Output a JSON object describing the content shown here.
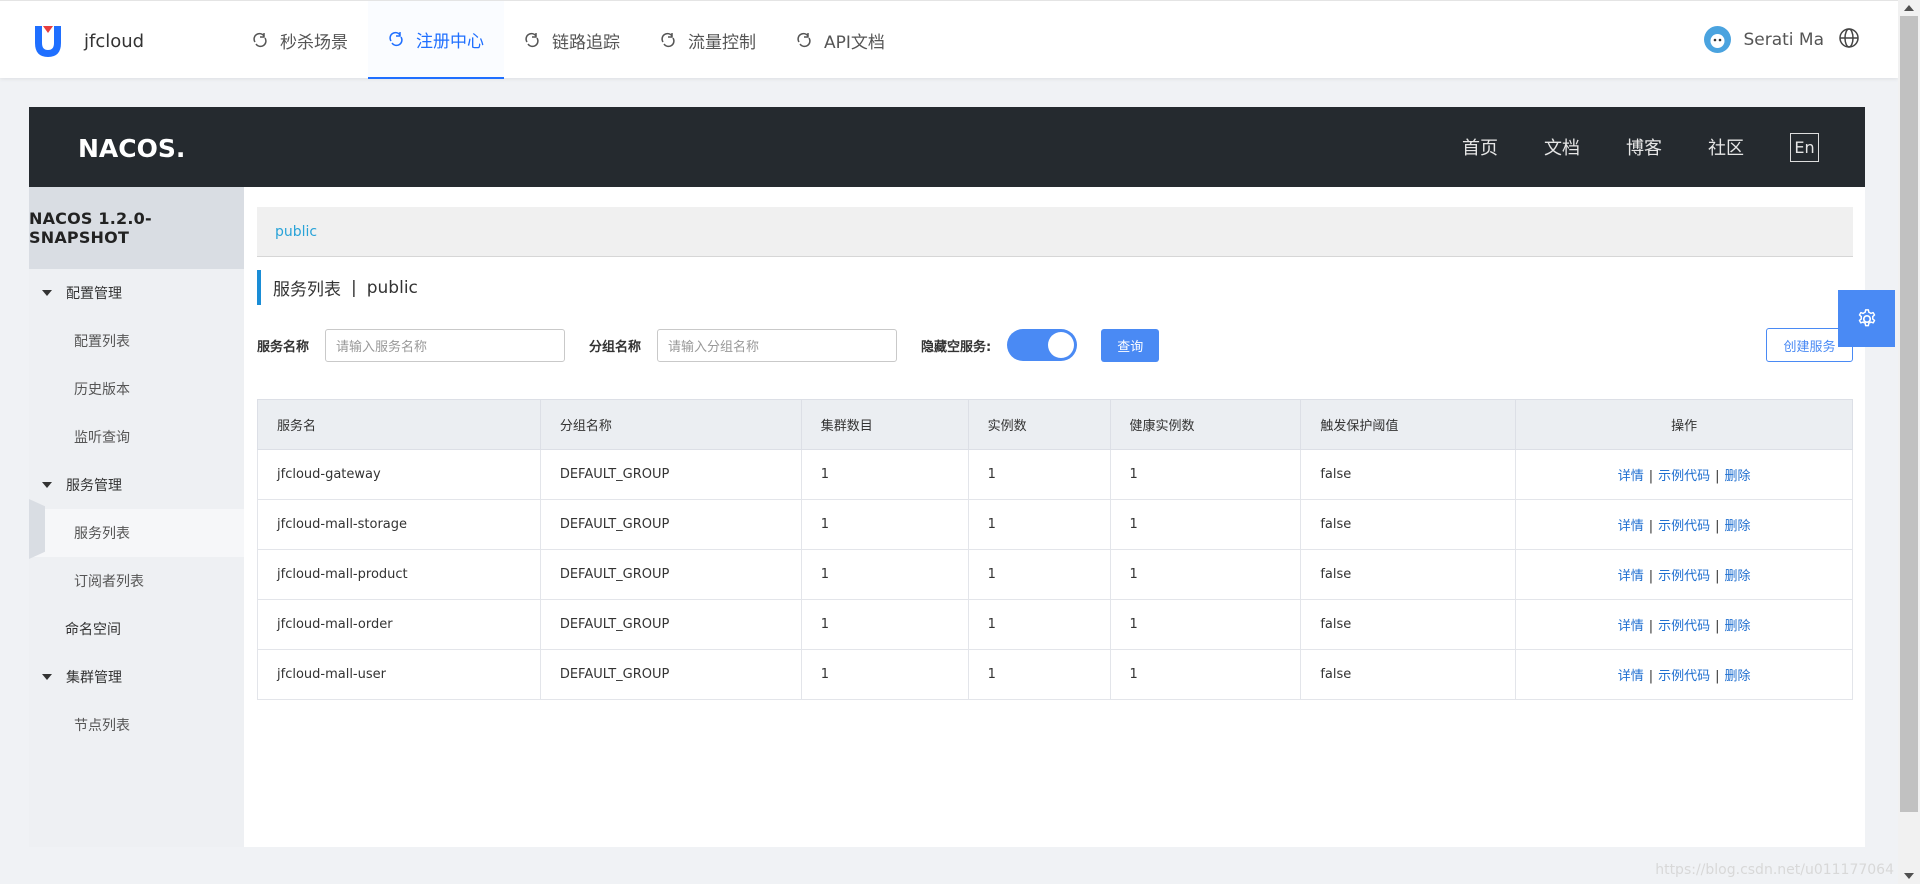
{
  "app": {
    "name": "jfcloud",
    "nav": [
      {
        "label": "秒杀场景",
        "active": false
      },
      {
        "label": "注册中心",
        "active": true
      },
      {
        "label": "链路追踪",
        "active": false
      },
      {
        "label": "流量控制",
        "active": false
      },
      {
        "label": "API文档",
        "active": false
      }
    ],
    "user_name": "Serati Ma",
    "accent": "#1f6fff"
  },
  "nacos": {
    "logo_text": "NACOS.",
    "nav": [
      "首页",
      "文档",
      "博客",
      "社区"
    ],
    "lang": "En",
    "header_bg": "#252a2f"
  },
  "sidebar": {
    "title": "NACOS 1.2.0-SNAPSHOT",
    "groups": [
      {
        "label": "配置管理",
        "items": [
          "配置列表",
          "历史版本",
          "监听查询"
        ]
      },
      {
        "label": "服务管理",
        "items": [
          "服务列表",
          "订阅者列表"
        ]
      },
      {
        "label": "命名空间",
        "items": []
      },
      {
        "label": "集群管理",
        "items": [
          "节点列表"
        ]
      }
    ],
    "active_item": "服务列表"
  },
  "main": {
    "breadcrumb": "public",
    "title": "服务列表",
    "title_sep": "|",
    "namespace": "public",
    "filters": {
      "service_label": "服务名称",
      "service_placeholder": "请输入服务名称",
      "group_label": "分组名称",
      "group_placeholder": "请输入分组名称",
      "hide_empty_label": "隐藏空服务:",
      "hide_empty_on": true,
      "query_label": "查询",
      "create_label": "创建服务"
    },
    "table": {
      "columns": [
        "服务名",
        "分组名称",
        "集群数目",
        "实例数",
        "健康实例数",
        "触发保护阈值",
        "操作"
      ],
      "rows": [
        {
          "name": "jfcloud-gateway",
          "group": "DEFAULT_GROUP",
          "clusters": "1",
          "instances": "1",
          "healthy": "1",
          "protect": "false"
        },
        {
          "name": "jfcloud-mall-storage",
          "group": "DEFAULT_GROUP",
          "clusters": "1",
          "instances": "1",
          "healthy": "1",
          "protect": "false"
        },
        {
          "name": "jfcloud-mall-product",
          "group": "DEFAULT_GROUP",
          "clusters": "1",
          "instances": "1",
          "healthy": "1",
          "protect": "false"
        },
        {
          "name": "jfcloud-mall-order",
          "group": "DEFAULT_GROUP",
          "clusters": "1",
          "instances": "1",
          "healthy": "1",
          "protect": "false"
        },
        {
          "name": "jfcloud-mall-user",
          "group": "DEFAULT_GROUP",
          "clusters": "1",
          "instances": "1",
          "healthy": "1",
          "protect": "false"
        }
      ],
      "actions": [
        "详情",
        "示例代码",
        "删除"
      ],
      "action_sep": "|"
    }
  },
  "watermark": "https://blog.csdn.net/u011177064"
}
